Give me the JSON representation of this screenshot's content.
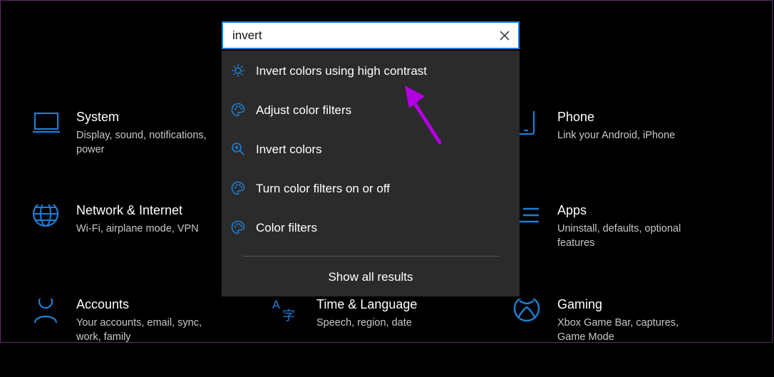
{
  "colors": {
    "accent": "#1e7fd6",
    "background": "#000000",
    "dropdown_bg": "#2b2b2b",
    "annotation": "#b200e0"
  },
  "search": {
    "value": "invert",
    "clear_icon": "close-icon"
  },
  "results": [
    {
      "label": "Invert colors using high contrast",
      "icon": "brightness-icon"
    },
    {
      "label": "Adjust color filters",
      "icon": "palette-icon"
    },
    {
      "label": "Invert colors",
      "icon": "magnifier-icon"
    },
    {
      "label": "Turn color filters on or off",
      "icon": "palette-icon"
    },
    {
      "label": "Color filters",
      "icon": "palette-icon"
    }
  ],
  "show_all_label": "Show all results",
  "categories": {
    "system": {
      "title": "System",
      "desc": "Display, sound, notifications, power",
      "icon": "laptop-icon"
    },
    "phone": {
      "title": "Phone",
      "desc": "Link your Android, iPhone",
      "icon": "phone-icon"
    },
    "network": {
      "title": "Network & Internet",
      "desc": "Wi-Fi, airplane mode, VPN",
      "icon": "globe-icon"
    },
    "apps": {
      "title": "Apps",
      "desc": "Uninstall, defaults, optional features",
      "icon": "apps-list-icon"
    },
    "accounts": {
      "title": "Accounts",
      "desc": "Your accounts, email, sync, work, family",
      "icon": "person-icon"
    },
    "time": {
      "title": "Time & Language",
      "desc": "Speech, region, date",
      "icon": "language-icon"
    },
    "gaming": {
      "title": "Gaming",
      "desc": "Xbox Game Bar, captures, Game Mode",
      "icon": "xbox-icon"
    }
  }
}
